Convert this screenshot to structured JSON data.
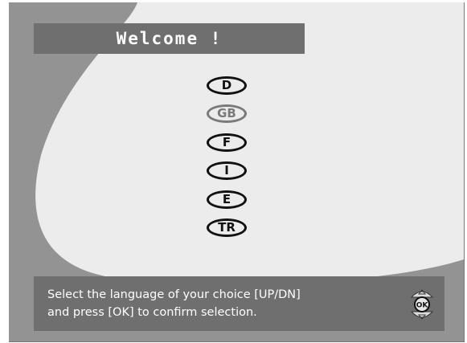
{
  "header": {
    "title": "Welcome !"
  },
  "languages": [
    {
      "code": "D",
      "selected": false
    },
    {
      "code": "GB",
      "selected": true
    },
    {
      "code": "F",
      "selected": false
    },
    {
      "code": "I",
      "selected": false
    },
    {
      "code": "E",
      "selected": false
    },
    {
      "code": "TR",
      "selected": false
    }
  ],
  "help": {
    "line1": "Select the language of your choice [UP/DN]",
    "line2": "and press [OK] to confirm selection.",
    "ok_label": "OK",
    "icon": "remote-updown-ok-icon"
  },
  "colors": {
    "background": "#939393",
    "swoosh": "#ececec",
    "bar": "#6f6f6f",
    "selected_outline": "#7a7a7a"
  }
}
